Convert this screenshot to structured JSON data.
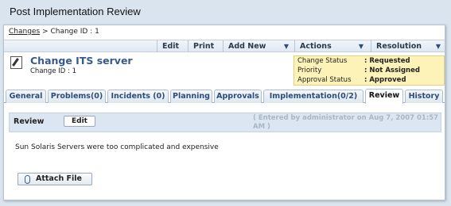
{
  "window": {
    "title": "Post Implementation Review"
  },
  "breadcrumb": {
    "link": "Changes",
    "separator": ">",
    "current": "Change ID : 1"
  },
  "toolbar": {
    "edit": "Edit",
    "print": "Print",
    "add_new": "Add New",
    "actions": "Actions",
    "resolution": "Resolution",
    "arrow": "▼"
  },
  "change": {
    "title": "Change ITS server",
    "id": "Change ID : 1",
    "icon": "edit-document-icon"
  },
  "status": {
    "change_status_label": "Change Status",
    "change_status_value": ": Requested",
    "priority_label": "Priority",
    "priority_value": ": Not Assigned",
    "approval_label": "Approval Status",
    "approval_value": ": Approved"
  },
  "tabs": [
    {
      "label": "General"
    },
    {
      "label": "Problems(0)"
    },
    {
      "label": "Incidents (0)"
    },
    {
      "label": "Planning"
    },
    {
      "label": "Approvals"
    },
    {
      "label": "Implementation(0/2)"
    },
    {
      "label": "Review"
    },
    {
      "label": "History"
    }
  ],
  "review": {
    "label": "Review",
    "edit_button": "Edit",
    "entered_by": "( Entered by administrator on Aug 7, 2007 01:57 AM )",
    "text": "Sun Solaris Servers were too complicated and expensive",
    "attach_button": "Attach File"
  },
  "colors": {
    "accent": "#365a8c",
    "status_bg": "#fdf3b8",
    "review_bar_bg": "#dbe6f2"
  }
}
